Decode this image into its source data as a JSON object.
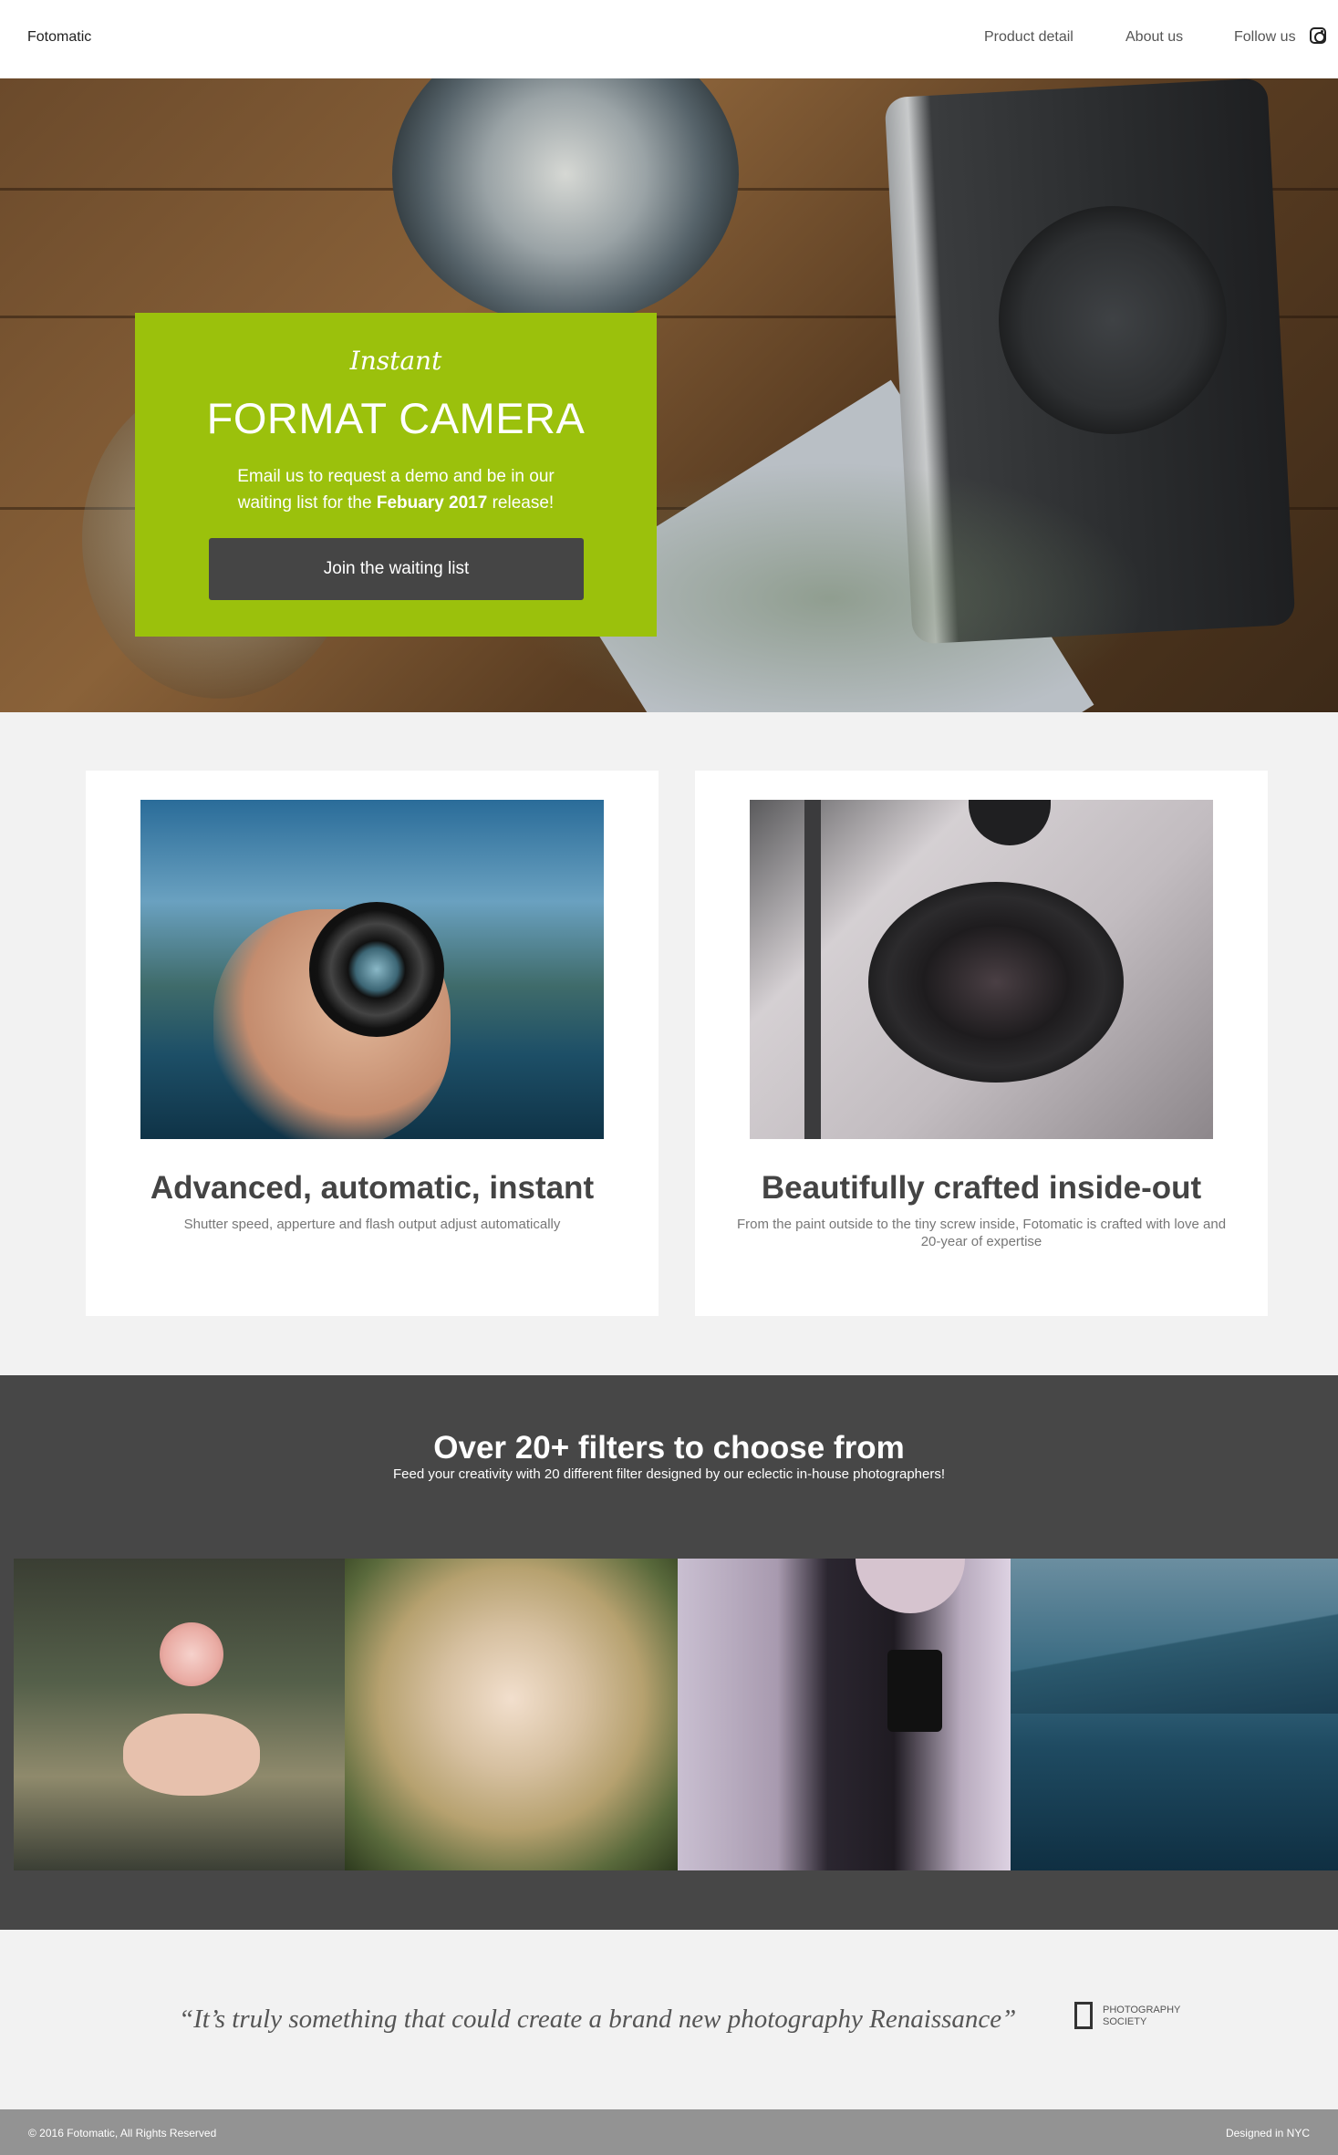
{
  "nav": {
    "brand": "Fotomatic",
    "links": [
      {
        "label": "Product detail"
      },
      {
        "label": "About us"
      },
      {
        "label": "Follow us"
      }
    ],
    "social_icon": "instagram-icon"
  },
  "hero": {
    "kicker": "Instant",
    "title": "FORMAT CAMERA",
    "text_before": "Email us to request a demo and be in our waiting list for the ",
    "text_bold": "Febuary 2017",
    "text_after": " release!",
    "button_label": "Join the waiting list",
    "accent_color": "#9bc10c"
  },
  "features": [
    {
      "title": "Advanced, automatic, instant",
      "text": "Shutter speed, apperture and flash output adjust automatically"
    },
    {
      "title": "Beautifully crafted inside-out",
      "text": "From the paint outside to the tiny screw inside, Fotomatic is crafted with love and 20-year of expertise"
    }
  ],
  "filters": {
    "title": "Over 20+ filters to choose from",
    "subtitle": "Feed your creativity with 20 different filter designed by our eclectic in-house photographers!"
  },
  "quote": {
    "text": "“It’s truly something that could create a brand new photography Renaissance”",
    "source_line1": "PHOTOGRAPHY",
    "source_line2": "SOCIETY"
  },
  "footer": {
    "left": "© 2016 Fotomatic, All Rights Reserved",
    "right": "Designed in NYC"
  }
}
